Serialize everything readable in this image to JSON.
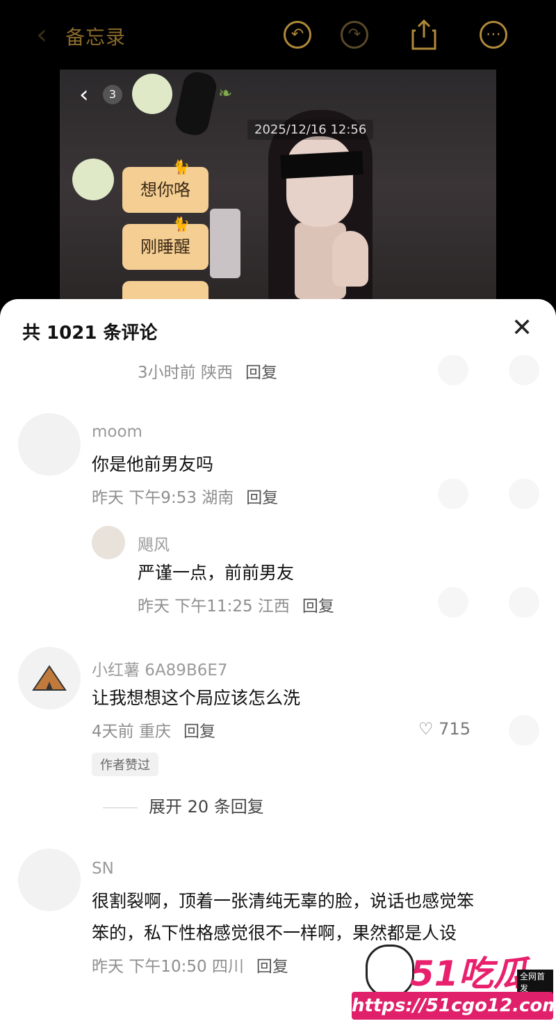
{
  "topbar": {
    "title": "备忘录",
    "undo_icon": "undo-icon",
    "redo_icon": "redo-icon",
    "share_icon": "share-icon",
    "more_icon": "more-icon"
  },
  "chat_screenshot": {
    "badge": "3",
    "timestamp": "2025/12/16 12:56",
    "messages": [
      "想你咯",
      "刚睡醒"
    ]
  },
  "sheet": {
    "title": "共 1021 条评论",
    "close_icon": "close-icon"
  },
  "comments": [
    {
      "meta": "3小时前 陕西",
      "reply": "回复"
    },
    {
      "user": "moom",
      "text": "你是他前男友吗",
      "meta": "昨天 下午9:53 湖南",
      "reply": "回复"
    },
    {
      "user": "飓风",
      "text": "严谨一点，前前男友",
      "meta": "昨天 下午11:25 江西",
      "reply": "回复"
    },
    {
      "user": "小红薯 6A89B6E7",
      "text": "让我想想这个局应该怎么洗",
      "meta": "4天前 重庆",
      "reply": "回复",
      "likes": "715",
      "tag": "作者赞过",
      "expand": "展开 20 条回复"
    },
    {
      "user": "SN",
      "text_line1": "很割裂啊，顶着一张清纯无辜的脸，说话也感觉笨",
      "text_line2": "笨的，私下性格感觉很不一样啊，果然都是人设",
      "meta": "昨天 下午10:50 四川",
      "reply": "回复"
    }
  ],
  "watermark": {
    "logo": "51吃瓜",
    "tag": "全网首发",
    "url": "https://51cgo12.com"
  },
  "colors": {
    "accent": "#b08a3a",
    "bubble": "#f4ce93",
    "watermark": "#e0206a"
  }
}
